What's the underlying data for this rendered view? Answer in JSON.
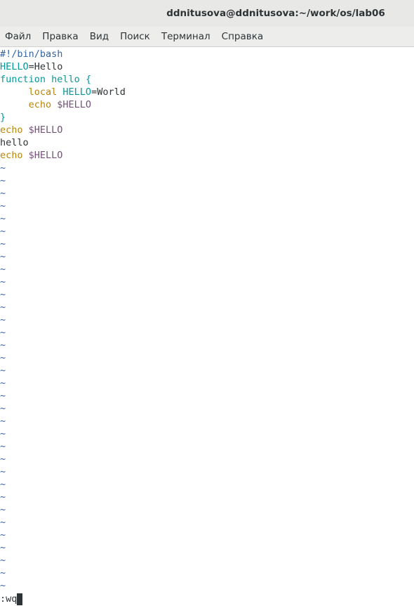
{
  "window": {
    "title": "ddnitusova@ddnitusova:~/work/os/lab06"
  },
  "menu": {
    "items": [
      "Файл",
      "Правка",
      "Вид",
      "Поиск",
      "Терминал",
      "Справка"
    ]
  },
  "editor": {
    "lines": [
      [
        {
          "t": "#!/bin/bash",
          "c": "c-comment"
        }
      ],
      [
        {
          "t": "HELLO",
          "c": "c-ident"
        },
        {
          "t": "=Hello",
          "c": "c-plain"
        }
      ],
      [
        {
          "t": "function",
          "c": "c-kw"
        },
        {
          "t": " ",
          "c": "c-plain"
        },
        {
          "t": "hello",
          "c": "c-ident"
        },
        {
          "t": " {",
          "c": "c-kw"
        }
      ],
      [
        {
          "t": "     ",
          "c": "c-plain"
        },
        {
          "t": "local",
          "c": "c-stmt"
        },
        {
          "t": " ",
          "c": "c-plain"
        },
        {
          "t": "HELLO",
          "c": "c-ident"
        },
        {
          "t": "=World",
          "c": "c-plain"
        }
      ],
      [
        {
          "t": "     ",
          "c": "c-plain"
        },
        {
          "t": "echo",
          "c": "c-stmt"
        },
        {
          "t": " ",
          "c": "c-plain"
        },
        {
          "t": "$HELLO",
          "c": "c-var"
        }
      ],
      [
        {
          "t": "}",
          "c": "c-kw"
        }
      ],
      [
        {
          "t": "echo",
          "c": "c-stmt"
        },
        {
          "t": " ",
          "c": "c-plain"
        },
        {
          "t": "$HELLO",
          "c": "c-var"
        }
      ],
      [
        {
          "t": "hello",
          "c": "c-plain"
        }
      ],
      [
        {
          "t": "echo",
          "c": "c-stmt"
        },
        {
          "t": " ",
          "c": "c-plain"
        },
        {
          "t": "$HELLO",
          "c": "c-var"
        }
      ]
    ],
    "empty_line_marker": "~",
    "empty_line_count": 34,
    "command_line": ":wq"
  },
  "colors": {
    "comment": "#3465a4",
    "identifier": "#06989a",
    "statement": "#b8860b",
    "variable": "#75507b",
    "tilde": "#3465a4",
    "text": "#2e3436"
  }
}
